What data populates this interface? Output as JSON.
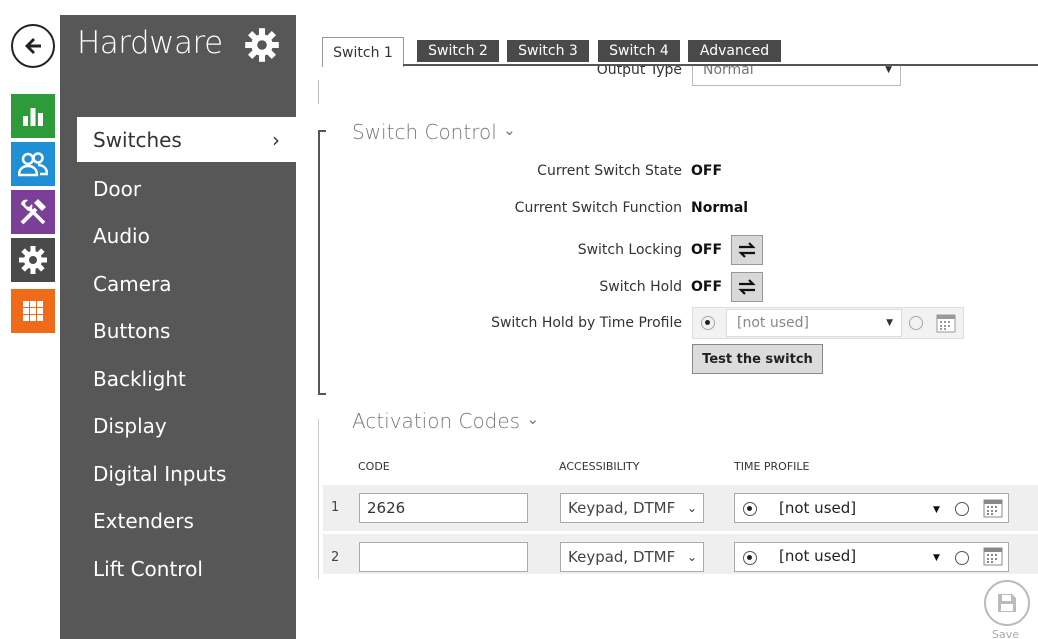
{
  "page": {
    "title": "Hardware"
  },
  "rail": {
    "back_icon": "arrow-left-icon",
    "items": [
      {
        "name": "status-icon",
        "color": "#2e9b3a"
      },
      {
        "name": "directory-icon",
        "color": "#1f8fd6"
      },
      {
        "name": "tools-icon",
        "color": "#7c3f98"
      },
      {
        "name": "settings-icon",
        "color": "#4a4a4a"
      },
      {
        "name": "grid-icon",
        "color": "#ef6b1a"
      }
    ]
  },
  "sidebar": {
    "items": [
      {
        "label": "Switches",
        "active": true,
        "chevron": "›"
      },
      {
        "label": "Door"
      },
      {
        "label": "Audio"
      },
      {
        "label": "Camera"
      },
      {
        "label": "Buttons"
      },
      {
        "label": "Backlight"
      },
      {
        "label": "Display"
      },
      {
        "label": "Digital Inputs"
      },
      {
        "label": "Extenders"
      },
      {
        "label": "Lift Control"
      }
    ]
  },
  "tabs": [
    "Switch 1",
    "Switch 2",
    "Switch 3",
    "Switch 4",
    "Advanced"
  ],
  "output_type": {
    "label": "Output Type",
    "value": "Normal"
  },
  "switch_control": {
    "title": "Switch Control",
    "toggle": "⌄",
    "state_label": "Current Switch State",
    "state_value": "OFF",
    "function_label": "Current Switch Function",
    "function_value": "Normal",
    "locking_label": "Switch Locking",
    "locking_value": "OFF",
    "hold_label": "Switch Hold",
    "hold_value": "OFF",
    "hold_profile_label": "Switch Hold by Time Profile",
    "hold_profile_value": "[not used]",
    "test_button": "Test the switch"
  },
  "activation_codes": {
    "title": "Activation Codes",
    "toggle": "⌄",
    "columns": [
      "CODE",
      "ACCESSIBILITY",
      "TIME PROFILE"
    ],
    "rows": [
      {
        "num": "1",
        "code": "2626",
        "accessibility": "Keypad, DTMF",
        "profile": "[not used]"
      },
      {
        "num": "2",
        "code": "",
        "accessibility": "Keypad, DTMF",
        "profile": "[not used]"
      }
    ]
  },
  "save": {
    "label": "Save"
  }
}
